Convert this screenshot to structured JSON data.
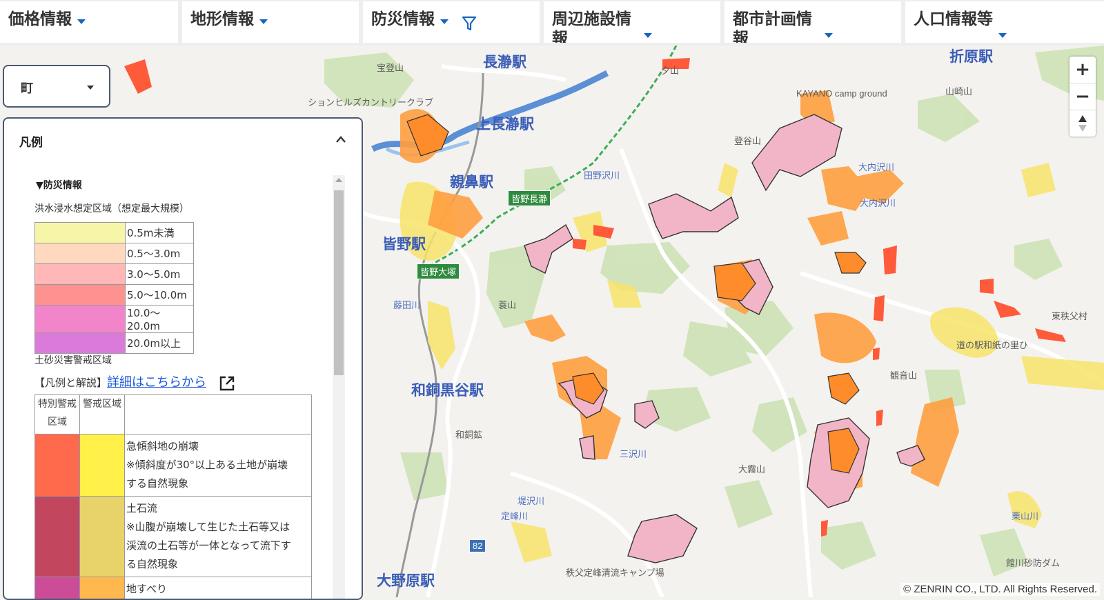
{
  "tabs": [
    {
      "label": "価格情報",
      "funnel": false
    },
    {
      "label": "地形情報",
      "funnel": false
    },
    {
      "label": "防災情報",
      "funnel": true
    },
    {
      "label": "周辺施設情報",
      "funnel": false
    },
    {
      "label": "都市計画情報",
      "funnel": false
    },
    {
      "label": "人口情報等",
      "funnel": false
    }
  ],
  "town_select": {
    "value": "町"
  },
  "zoom": {
    "in": "+",
    "out": "−"
  },
  "legend": {
    "title": "凡例",
    "section": "▼防災情報",
    "flood": {
      "title": "洪水浸水想定区域（想定最大規模）",
      "rows": [
        {
          "label": "0.5m未満",
          "color": "#f7f5a8"
        },
        {
          "label": "0.5～3.0m",
          "color": "#ffd8c0"
        },
        {
          "label": "3.0～5.0m",
          "color": "#ffb7b7"
        },
        {
          "label": "5.0～10.0m",
          "color": "#ff9191"
        },
        {
          "label": "10.0～20.0m",
          "color": "#f285c9"
        },
        {
          "label": "20.0m以上",
          "color": "#dc7adc"
        }
      ]
    },
    "sediment": {
      "title": "土砂災害警戒区域",
      "explain_prefix": "【凡例と解説】",
      "explain_link": "詳細はこちらから",
      "header_special": "特別警戒区域",
      "header_warning": "警戒区域",
      "rows": [
        {
          "special_color": "#ff6a4d",
          "warning_color": "#fff04a",
          "lines": [
            "急傾斜地の崩壊",
            "※傾斜度が30°以上ある土地が崩壊",
            "する自然現象"
          ]
        },
        {
          "special_color": "#c2475e",
          "warning_color": "#e8d36b",
          "lines": [
            "土石流",
            "※山腹が崩壊して生じた土石等又は",
            "渓流の土石等が一体となって流下す",
            "る自然現象"
          ]
        },
        {
          "special_color": "#cc4c98",
          "warning_color": "#ffb84d",
          "lines": [
            "地すべり"
          ]
        }
      ]
    }
  },
  "map_labels": {
    "nagatoro_station": "長瀞駅",
    "kami_nagatoro_station": "上長瀞駅",
    "oyahana_station": "親鼻駅",
    "minano_station": "皆野駅",
    "wadokuroya_station": "和銅黒谷駅",
    "onohara_station": "大野原駅",
    "orihara_station": "折原駅",
    "hodosan": "宝登山",
    "country_club": "ションヒルズカントリークラブ",
    "kayano_camp": "KAYANO camp ground",
    "tonoyama": "登谷山",
    "tanonosawa": "田野沢川",
    "ouchisawa1": "大内沢川",
    "ouchisawa2": "大内沢川",
    "kannonyama": "観音山",
    "oyumiyama": "大霧山",
    "michinoeki": "道の駅和紙の里ひ",
    "higashichichibu": "東秩父村",
    "sanzawa": "三沢川",
    "jozawa": "堤沢川",
    "teiminezawa": "定峰川",
    "kuriyama": "栗山川",
    "camp": "秩父定峰清流キャンプ場",
    "damu": "館川砂防ダム",
    "hakuyama": "蓑山",
    "fujita": "藤田川",
    "wadokoseki": "和銅鉱",
    "route82": "82",
    "minano_nagatoro_ic": "皆野長瀞",
    "minano_osato_ic": "皆野大塚",
    "yamasakisan": "山崎山",
    "oyoshi": "夕山"
  },
  "copyright": "© ZENRIN CO., LTD. All Rights Reserved."
}
